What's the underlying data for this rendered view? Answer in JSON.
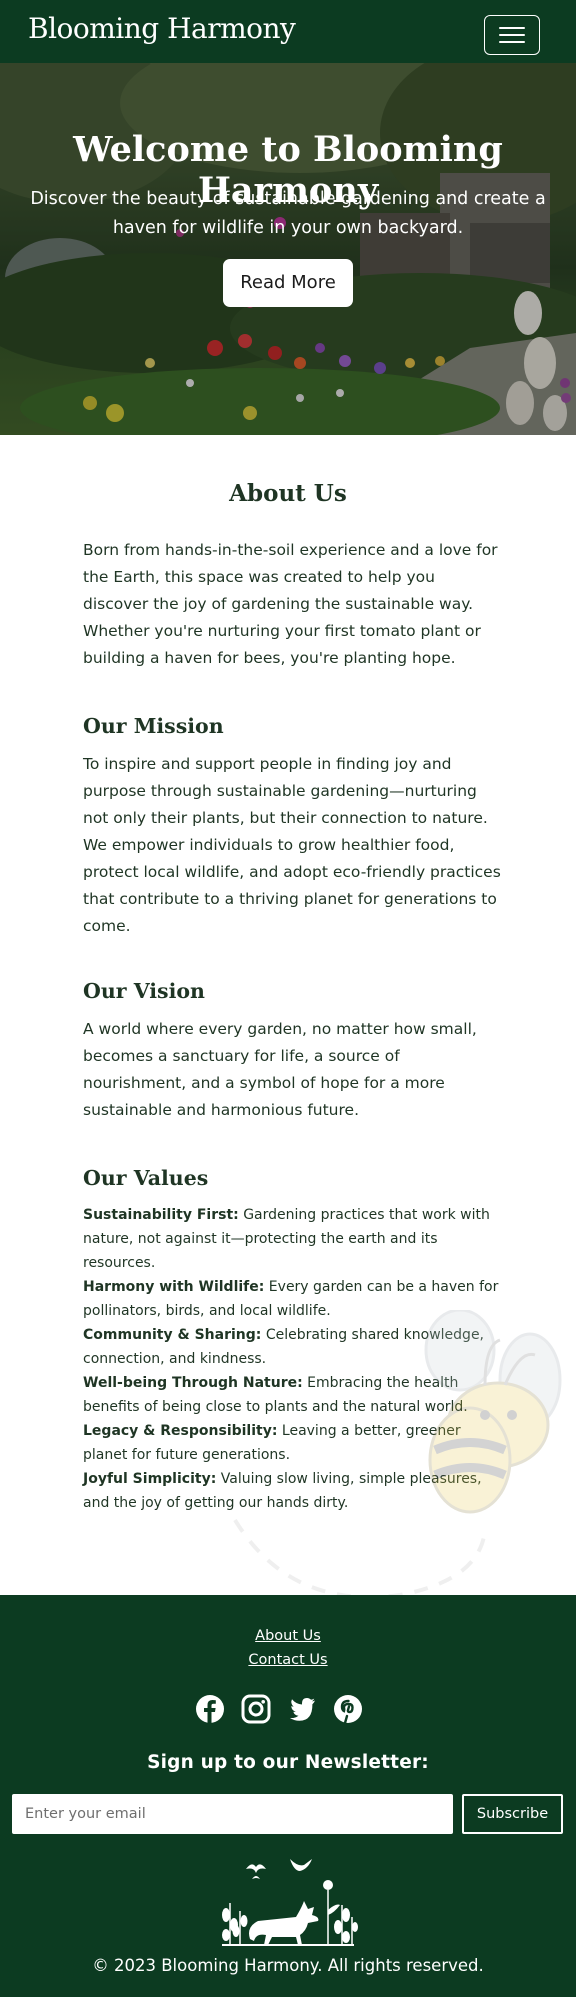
{
  "navbar": {
    "brand": "Blooming Harmony",
    "menu_icon": "hamburger-menu-icon"
  },
  "hero": {
    "title": "Welcome to Blooming Harmony",
    "subtitle": "Discover the beauty of sustainable gardening and create a haven for wildlife in your own backyard.",
    "button_label": "Read More"
  },
  "about": {
    "heading": "About Us",
    "body": "Born from hands-in-the-soil experience and a love for the Earth, this space was created to help you discover the joy of gardening the sustainable way. Whether you're nurturing your first tomato plant or building a haven for bees, you're planting hope."
  },
  "mission": {
    "heading": "Our Mission",
    "body": "To inspire and support people in finding joy and purpose through sustainable gardening—nurturing not only their plants, but their connection to nature. We empower individuals to grow healthier food, protect local wildlife, and adopt eco-friendly practices that contribute to a thriving planet for generations to come."
  },
  "vision": {
    "heading": "Our Vision",
    "body": "A world where every garden, no matter how small, becomes a sanctuary for life, a source of nourishment, and a symbol of hope for a more sustainable and harmonious future."
  },
  "values": {
    "heading": "Our Values",
    "items": [
      {
        "title": "Sustainability First:",
        "text": " Gardening practices that work with nature, not against it—protecting the earth and its resources."
      },
      {
        "title": "Harmony with Wildlife:",
        "text": " Every garden can be a haven for pollinators, birds, and local wildlife."
      },
      {
        "title": "Community & Sharing:",
        "text": " Celebrating shared knowledge, connection, and kindness."
      },
      {
        "title": "Well-being Through Nature:",
        "text": " Embracing the health benefits of being close to plants and the natural world."
      },
      {
        "title": "Legacy & Responsibility:",
        "text": " Leaving a better, greener planet for future generations."
      },
      {
        "title": "Joyful Simplicity:",
        "text": " Valuing slow living, simple pleasures, and the joy of getting our hands dirty."
      }
    ]
  },
  "footer": {
    "links": [
      "About Us",
      "Contact Us"
    ],
    "social_icons": [
      "facebook-icon",
      "instagram-icon",
      "twitter-icon",
      "pinterest-icon"
    ],
    "newsletter_title": "Sign up to our Newsletter:",
    "email_placeholder": "Enter your email",
    "subscribe_label": "Subscribe",
    "copyright": "© 2023 Blooming Harmony. All rights reserved."
  },
  "colors": {
    "primary_green": "#0c3b21",
    "text": "#1f3524",
    "white": "#ffffff"
  }
}
